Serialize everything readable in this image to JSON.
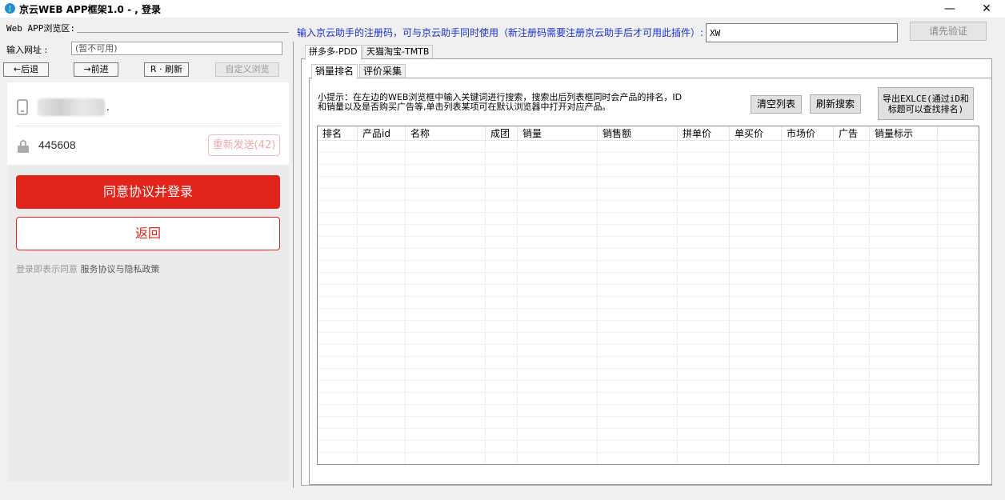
{
  "window": {
    "title": "京云WEB APP框架1.0 - , 登录",
    "icon": "app-icon",
    "minimize_glyph": "—",
    "close_glyph": "✕"
  },
  "browser": {
    "area_label": "Web APP浏览区:",
    "url_label": "输入网址 :",
    "url_value": "(暂不可用)",
    "back_label": "←后退",
    "forward_label": "→前进",
    "refresh_label": "R · 刷新",
    "custom_browse_label": "自定义浏览"
  },
  "login": {
    "phone_suffix": ".",
    "code_value": "445608",
    "resend_label": "重新发送(42)",
    "agree_button": "同意协议并登录",
    "back_button": "返回",
    "terms_prefix": "登录即表示同意",
    "terms_link": "服务协议与隐私政策",
    "accent_color": "#e1251b"
  },
  "registration": {
    "label": "输入京云助手的注册码，可与京云助手同时使用（新注册码需要注册京云助手后才可用此插件）:",
    "code_value": "XW",
    "verify_button": "请先验证",
    "label_color": "#1b2fcf"
  },
  "platform_tabs": [
    {
      "label": "拼多多-PDD",
      "active": true
    },
    {
      "label": "天猫淘宝-TMTB",
      "active": false
    }
  ],
  "sub_tabs": [
    {
      "label": "销量排名",
      "active": true
    },
    {
      "label": "评价采集",
      "active": false
    }
  ],
  "ranking": {
    "hint_line1": "小提示：在左边的WEB浏览框中输入关键词进行搜索，搜索出后列表框同时会产品的排名，ID",
    "hint_line2": "和销量以及是否购买广告等,单击列表某项可在默认浏览器中打开对应产品。",
    "clear_button": "清空列表",
    "refresh_button": "刷新搜索",
    "export_line1": "导出EXLCE(通过iD和",
    "export_line2": "标题可以查找排名)",
    "columns": [
      "排名",
      "产品id",
      "名称",
      "成团",
      "销量",
      "销售额",
      "拼单价",
      "单买价",
      "市场价",
      "广告",
      "销量标示"
    ],
    "rows": []
  }
}
